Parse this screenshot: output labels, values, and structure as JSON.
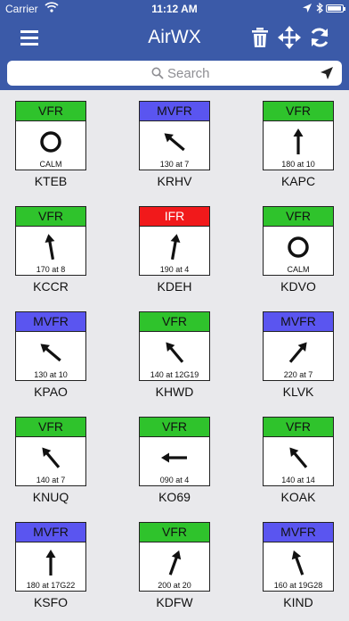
{
  "status_bar": {
    "carrier": "Carrier",
    "time": "11:12 AM",
    "battery_level": 0.95,
    "icons": [
      "wifi-icon",
      "location-arrow-icon",
      "bluetooth-icon",
      "battery-icon"
    ]
  },
  "nav": {
    "title": "AirWX",
    "icons": [
      "menu-icon",
      "trash-icon",
      "move-icon",
      "refresh-icon"
    ]
  },
  "search": {
    "placeholder": "Search",
    "icons": [
      "search-icon",
      "location-arrow-icon"
    ]
  },
  "colors": {
    "bar": "#3b5aa8",
    "VFR": "#2fc32c",
    "MVFR": "#5a55f0",
    "IFR": "#f1191b",
    "background": "#e9e9ec"
  },
  "stations": [
    {
      "id": "KTEB",
      "category": "VFR",
      "wind": "CALM",
      "dir": null
    },
    {
      "id": "KRHV",
      "category": "MVFR",
      "wind": "130 at 7",
      "dir": 130
    },
    {
      "id": "KAPC",
      "category": "VFR",
      "wind": "180 at 10",
      "dir": 180
    },
    {
      "id": "KCCR",
      "category": "VFR",
      "wind": "170 at 8",
      "dir": 170
    },
    {
      "id": "KDEH",
      "category": "IFR",
      "wind": "190 at 4",
      "dir": 190
    },
    {
      "id": "KDVO",
      "category": "VFR",
      "wind": "CALM",
      "dir": null
    },
    {
      "id": "KPAO",
      "category": "MVFR",
      "wind": "130 at 10",
      "dir": 130
    },
    {
      "id": "KHWD",
      "category": "VFR",
      "wind": "140 at 12G19",
      "dir": 140
    },
    {
      "id": "KLVK",
      "category": "MVFR",
      "wind": "220 at 7",
      "dir": 220
    },
    {
      "id": "KNUQ",
      "category": "VFR",
      "wind": "140 at 7",
      "dir": 140
    },
    {
      "id": "KO69",
      "category": "VFR",
      "wind": "090 at 4",
      "dir": 90
    },
    {
      "id": "KOAK",
      "category": "VFR",
      "wind": "140 at 14",
      "dir": 140
    },
    {
      "id": "KSFO",
      "category": "MVFR",
      "wind": "180 at 17G22",
      "dir": 180
    },
    {
      "id": "KDFW",
      "category": "VFR",
      "wind": "200 at 20",
      "dir": 200
    },
    {
      "id": "KIND",
      "category": "MVFR",
      "wind": "160 at 19G28",
      "dir": 160
    }
  ]
}
